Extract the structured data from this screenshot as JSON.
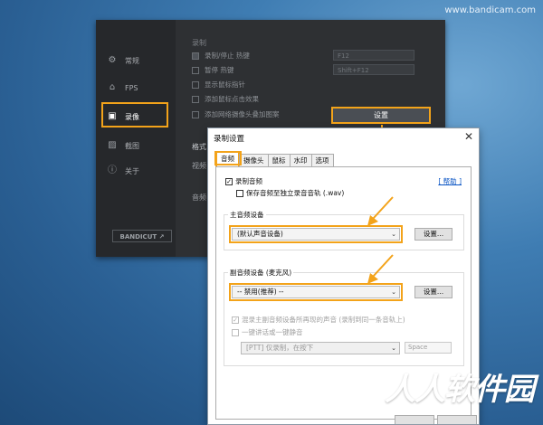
{
  "watermark": "www.bandicam.com",
  "bandicam": {
    "section_title": "录制",
    "sidebar": [
      {
        "label": "常规",
        "icon": "gear-icon",
        "active": false
      },
      {
        "label": "FPS",
        "icon": "fps-icon",
        "active": false
      },
      {
        "label": "录像",
        "icon": "video-record-icon",
        "active": true
      },
      {
        "label": "截图",
        "icon": "image-icon",
        "active": false
      },
      {
        "label": "关于",
        "icon": "info-icon",
        "active": false
      }
    ],
    "options": [
      {
        "label": "录制/停止 热键",
        "checked": true,
        "hotkey": "F12"
      },
      {
        "label": "暂停 热键",
        "checked": false,
        "hotkey": "Shift+F12"
      },
      {
        "label": "显示鼠标指针",
        "checked": false
      },
      {
        "label": "添加鼠标点击效果",
        "checked": false
      },
      {
        "label": "添加网络摄像头叠加图案",
        "checked": false
      }
    ],
    "settings_button": "设置",
    "format_label": "格式",
    "video_label": "视频",
    "audio_label": "音频",
    "bandicut_label": "BANDICUT ↗"
  },
  "dialog": {
    "title": "录制设置",
    "close": "✕",
    "tabs": [
      {
        "label": "音频",
        "active": true
      },
      {
        "label": "摄像头",
        "active": false
      },
      {
        "label": "鼠标",
        "active": false
      },
      {
        "label": "水印",
        "active": false
      },
      {
        "label": "选项",
        "active": false
      }
    ],
    "help_link": "[ 帮助 ]",
    "record_audio": {
      "label": "录制音频",
      "checked": true
    },
    "save_separate": {
      "label": "保存音频至独立录音音轨 (.wav)",
      "checked": false
    },
    "primary": {
      "title": "主音频设备",
      "selected": "(默认声音设备)",
      "settings_button": "设置..."
    },
    "secondary": {
      "title": "副音频设备 (麦克风)",
      "selected": "-- 禁用(推荐) --",
      "settings_button": "设置..."
    },
    "mix_option": {
      "label": "混录主副音频设备所再现的声音 (录制到同一条音轨上)",
      "checked": true,
      "disabled": true
    },
    "ptt_option": {
      "label": "一键讲话或一键静音",
      "checked": false,
      "disabled": true
    },
    "ptt_select": "[PTT] 仅录制，在按下",
    "ptt_key": "Space"
  },
  "logo_text": "人人软件园",
  "colors": {
    "highlight": "#f3a31a",
    "link": "#0b55c4"
  }
}
